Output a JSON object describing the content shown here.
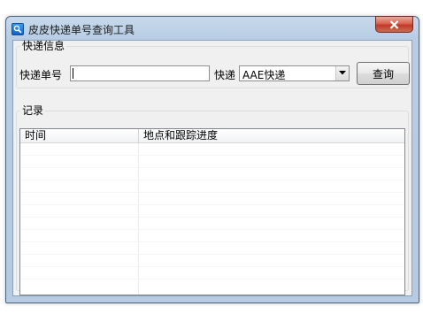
{
  "window": {
    "title": "皮皮快递单号查询工具"
  },
  "info_group": {
    "legend": "快递信息",
    "tracking_label": "快递单号",
    "tracking_value": "",
    "courier_label": "快递",
    "courier_selected": "AAE快递",
    "query_button": "查询"
  },
  "records_group": {
    "legend": "记录",
    "columns": [
      "时间",
      "地点和跟踪进度"
    ],
    "rows": []
  },
  "icons": {
    "app": "search-icon",
    "close": "close-icon",
    "dropdown": "chevron-down-icon"
  },
  "colors": {
    "close_button": "#c0392b",
    "titlebar": "#c7d9ec",
    "client_bg": "#f0f0f0"
  }
}
